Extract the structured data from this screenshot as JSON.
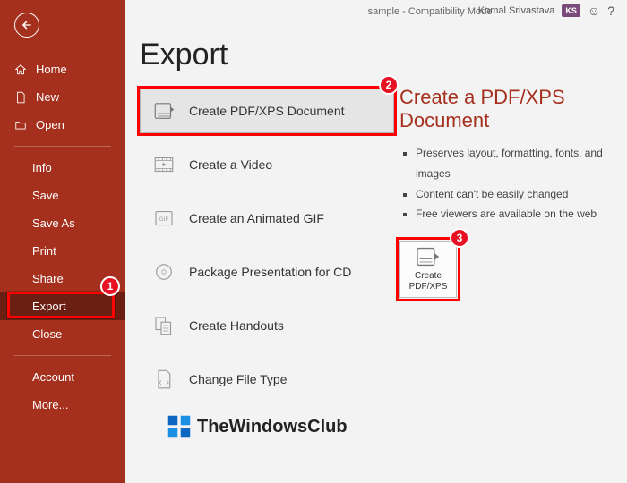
{
  "titlebar": {
    "title": "sample  -  Compatibility Mode",
    "username": "Komal Srivastava",
    "initials": "KS"
  },
  "sidebar": {
    "home": "Home",
    "new": "New",
    "open": "Open",
    "info": "Info",
    "save": "Save",
    "save_as": "Save As",
    "print": "Print",
    "share": "Share",
    "export": "Export",
    "close": "Close",
    "account": "Account",
    "more": "More..."
  },
  "page": {
    "heading": "Export",
    "options": {
      "pdfxps": "Create PDF/XPS Document",
      "video": "Create a Video",
      "gif": "Create an Animated GIF",
      "package": "Package Presentation for CD",
      "handouts": "Create Handouts",
      "filetype": "Change File Type"
    }
  },
  "detail": {
    "heading": "Create a PDF/XPS Document",
    "bullets": {
      "b1": "Preserves layout, formatting, fonts, and images",
      "b2": "Content can't be easily changed",
      "b3": "Free viewers are available on the web"
    },
    "button_label": "Create PDF/XPS"
  },
  "annotations": {
    "c1": "1",
    "c2": "2",
    "c3": "3"
  },
  "watermark": "TheWindowsClub"
}
